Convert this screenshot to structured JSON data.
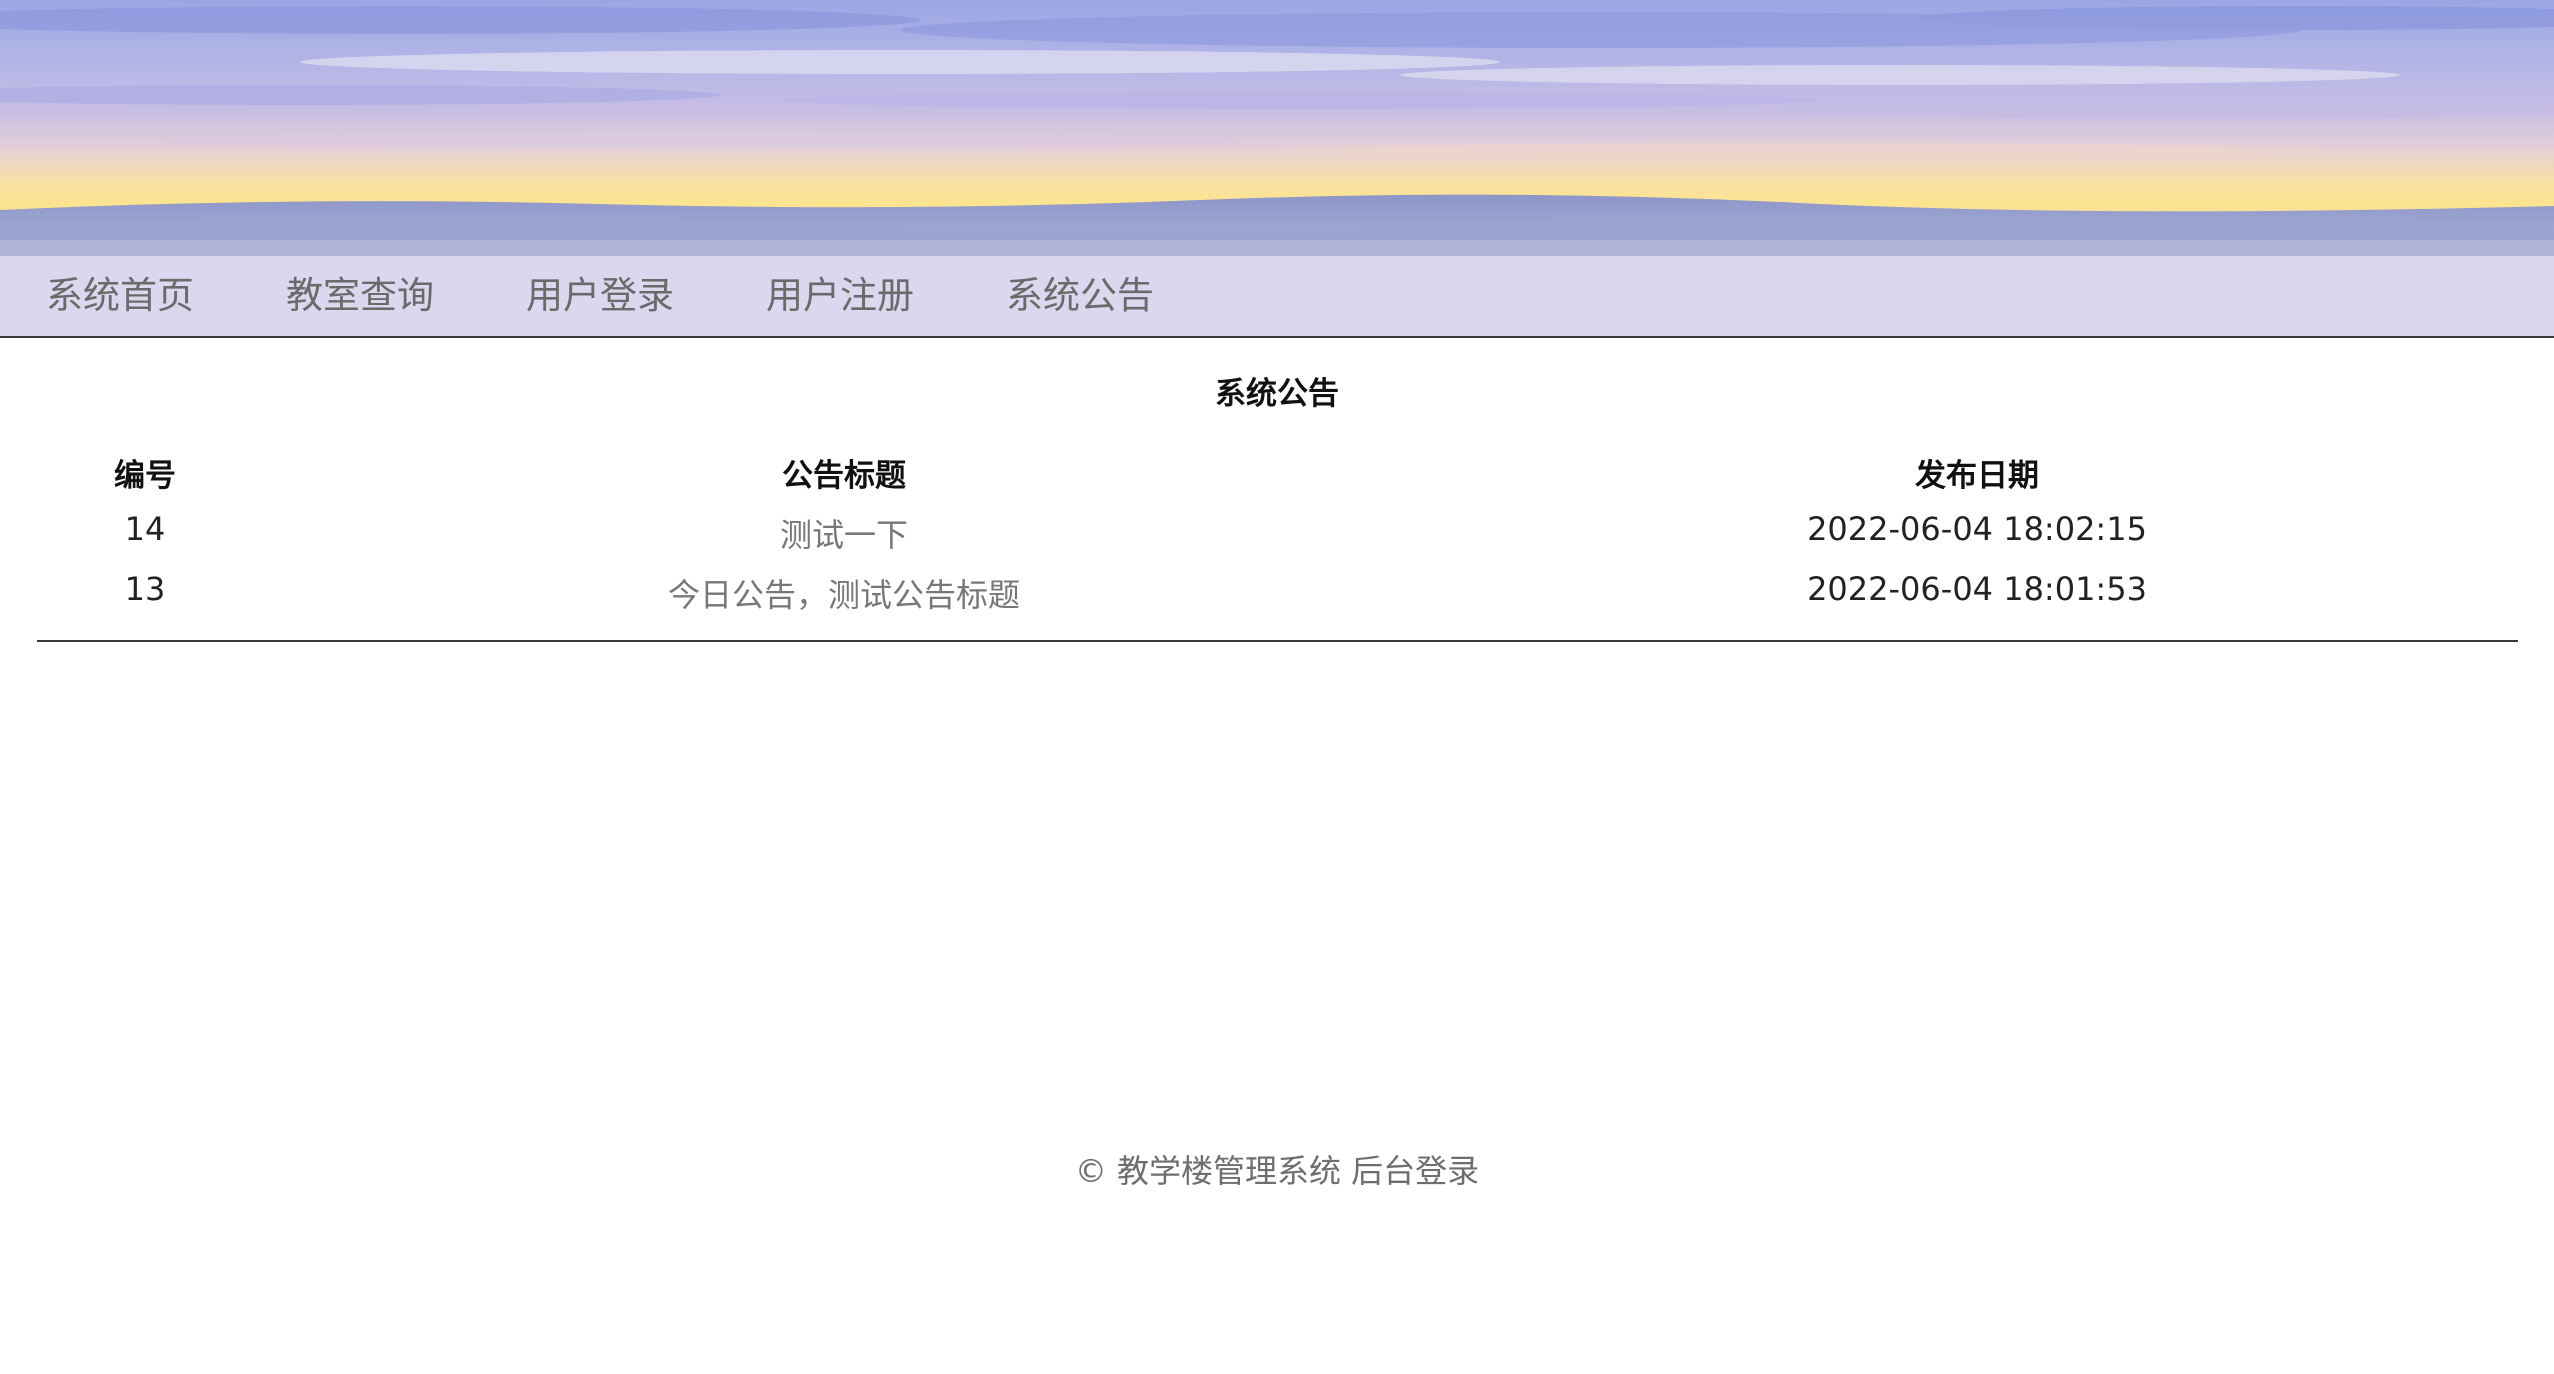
{
  "nav": {
    "items": [
      {
        "label": "系统首页"
      },
      {
        "label": "教室查询"
      },
      {
        "label": "用户登录"
      },
      {
        "label": "用户注册"
      },
      {
        "label": "系统公告"
      }
    ]
  },
  "notice": {
    "title": "系统公告",
    "headers": {
      "id": "编号",
      "title": "公告标题",
      "date": "发布日期"
    },
    "rows": [
      {
        "id": "14",
        "title": "测试一下",
        "date": "2022-06-04 18:02:15"
      },
      {
        "id": "13",
        "title": "今日公告，测试公告标题",
        "date": "2022-06-04 18:01:53"
      }
    ]
  },
  "footer": {
    "copyright": "© 教学楼管理系统",
    "admin_link": "后台登录"
  },
  "colors": {
    "nav_bg": "#dcd7ee",
    "nav_text": "#6a6a6a",
    "link_text": "#777777"
  }
}
